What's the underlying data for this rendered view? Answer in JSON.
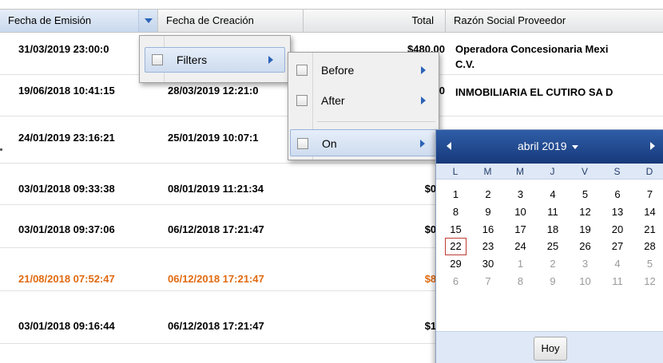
{
  "grid": {
    "columns": [
      "Fecha de Emisión",
      "Fecha de Creación",
      "Total",
      "Razón Social Proveedor"
    ],
    "rows": [
      {
        "emision": "31/03/2019 23:00:0",
        "creacion": "",
        "total": "$480.00",
        "proveedor": "Operadora Concesionaria Mexi",
        "proveedor2": "C.V.",
        "status": "normal"
      },
      {
        "emision": "19/06/2018 10:41:15",
        "creacion": "28/03/2019 12:21:0",
        "total": "0",
        "proveedor": "INMOBILIARIA EL CUTIRO SA D",
        "proveedor2": "",
        "status": "normal"
      },
      {
        "emision": "24/01/2019 23:16:21",
        "creacion": "25/01/2019 10:07:1",
        "total": "",
        "proveedor": "",
        "proveedor2": "",
        "status": "normal"
      },
      {
        "emision": "03/01/2018 09:33:38",
        "creacion": "08/01/2019 11:21:34",
        "total": "$0.0",
        "proveedor": "",
        "proveedor2": "",
        "status": "normal"
      },
      {
        "emision": "03/01/2018 09:37:06",
        "creacion": "06/12/2018 17:21:47",
        "total": "$0.0",
        "proveedor": "",
        "proveedor2": "",
        "status": "normal"
      },
      {
        "emision": "21/08/2018 07:52:47",
        "creacion": "06/12/2018 17:21:47",
        "total": "$8.0",
        "proveedor": "",
        "proveedor2": "",
        "status": "warn"
      },
      {
        "emision": "03/01/2018 09:16:44",
        "creacion": "06/12/2018 17:21:47",
        "total": "$1.0",
        "proveedor": "",
        "proveedor2": "",
        "status": "normal"
      }
    ]
  },
  "column_menu": {
    "items": [
      {
        "label": "Filters",
        "checked": false,
        "has_submenu": true
      }
    ]
  },
  "filter_menu": {
    "items": [
      {
        "label": "Before",
        "checked": false,
        "has_submenu": true
      },
      {
        "label": "After",
        "checked": false,
        "has_submenu": true
      },
      {
        "label": "On",
        "checked": false,
        "has_submenu": true
      }
    ]
  },
  "datepicker": {
    "month_label": "abril 2019",
    "weekdays": [
      "L",
      "M",
      "M",
      "J",
      "V",
      "S",
      "D"
    ],
    "weeks": [
      [
        {
          "d": "1"
        },
        {
          "d": "2"
        },
        {
          "d": "3"
        },
        {
          "d": "4"
        },
        {
          "d": "5"
        },
        {
          "d": "6"
        },
        {
          "d": "7"
        }
      ],
      [
        {
          "d": "8"
        },
        {
          "d": "9"
        },
        {
          "d": "10"
        },
        {
          "d": "11"
        },
        {
          "d": "12"
        },
        {
          "d": "13"
        },
        {
          "d": "14"
        }
      ],
      [
        {
          "d": "15"
        },
        {
          "d": "16"
        },
        {
          "d": "17"
        },
        {
          "d": "18"
        },
        {
          "d": "19"
        },
        {
          "d": "20"
        },
        {
          "d": "21"
        }
      ],
      [
        {
          "d": "22",
          "today": true
        },
        {
          "d": "23"
        },
        {
          "d": "24"
        },
        {
          "d": "25"
        },
        {
          "d": "26"
        },
        {
          "d": "27"
        },
        {
          "d": "28"
        }
      ],
      [
        {
          "d": "29"
        },
        {
          "d": "30"
        },
        {
          "d": "1",
          "other": true
        },
        {
          "d": "2",
          "other": true
        },
        {
          "d": "3",
          "other": true
        },
        {
          "d": "4",
          "other": true
        },
        {
          "d": "5",
          "other": true
        }
      ],
      [
        {
          "d": "6",
          "other": true
        },
        {
          "d": "7",
          "other": true
        },
        {
          "d": "8",
          "other": true
        },
        {
          "d": "9",
          "other": true
        },
        {
          "d": "10",
          "other": true
        },
        {
          "d": "11",
          "other": true
        },
        {
          "d": "12",
          "other": true
        }
      ]
    ],
    "today_label": "Hoy"
  },
  "colors": {
    "accent": "#2b63b8",
    "picker_header": "#17397a",
    "warn_text": "#e06a10",
    "today_border": "#c03a32"
  },
  "icons": {
    "header_trigger": "triangle-down-icon",
    "submenu": "triangle-right-icon",
    "prev": "triangle-left-icon",
    "next": "triangle-right-icon",
    "checkbox": "checkbox-icon"
  }
}
